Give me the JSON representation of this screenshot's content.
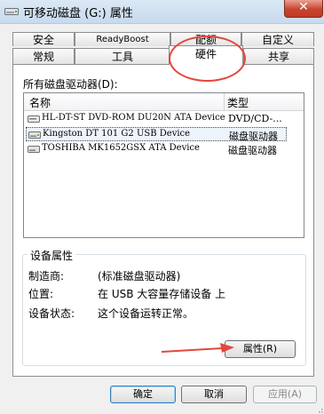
{
  "window": {
    "title": "可移动磁盘 (G:) 属性",
    "close_glyph": "✕"
  },
  "tabs": {
    "row1": [
      "安全",
      "ReadyBoost",
      "配额",
      "自定义"
    ],
    "row2": [
      "常规",
      "工具",
      "硬件",
      "共享"
    ],
    "active": "硬件"
  },
  "hardware": {
    "all_drives_label": "所有磁盘驱动器(D):",
    "columns": {
      "name": "名称",
      "type": "类型"
    },
    "devices": [
      {
        "name": "HL-DT-ST DVD-ROM DU20N ATA Device",
        "type": "DVD/CD-...",
        "icon": "optical-drive-icon"
      },
      {
        "name": "Kingston DT 101 G2 USB Device",
        "type": "磁盘驱动器",
        "icon": "usb-disk-icon"
      },
      {
        "name": "TOSHIBA MK1652GSX ATA Device",
        "type": "磁盘驱动器",
        "icon": "hard-disk-icon"
      }
    ],
    "selected_index": 1
  },
  "device_properties": {
    "group_title": "设备属性",
    "manufacturer_label": "制造商:",
    "manufacturer_value": "(标准磁盘驱动器)",
    "location_label": "位置:",
    "location_value": "在 USB 大容量存储设备 上",
    "status_label": "设备状态:",
    "status_value": "这个设备运转正常。",
    "properties_button": "属性(R)"
  },
  "buttons": {
    "ok": "确定",
    "cancel": "取消",
    "apply": "应用(A)"
  },
  "colors": {
    "annotation": "#e3473c",
    "selection_border": "#4a4a4a"
  }
}
